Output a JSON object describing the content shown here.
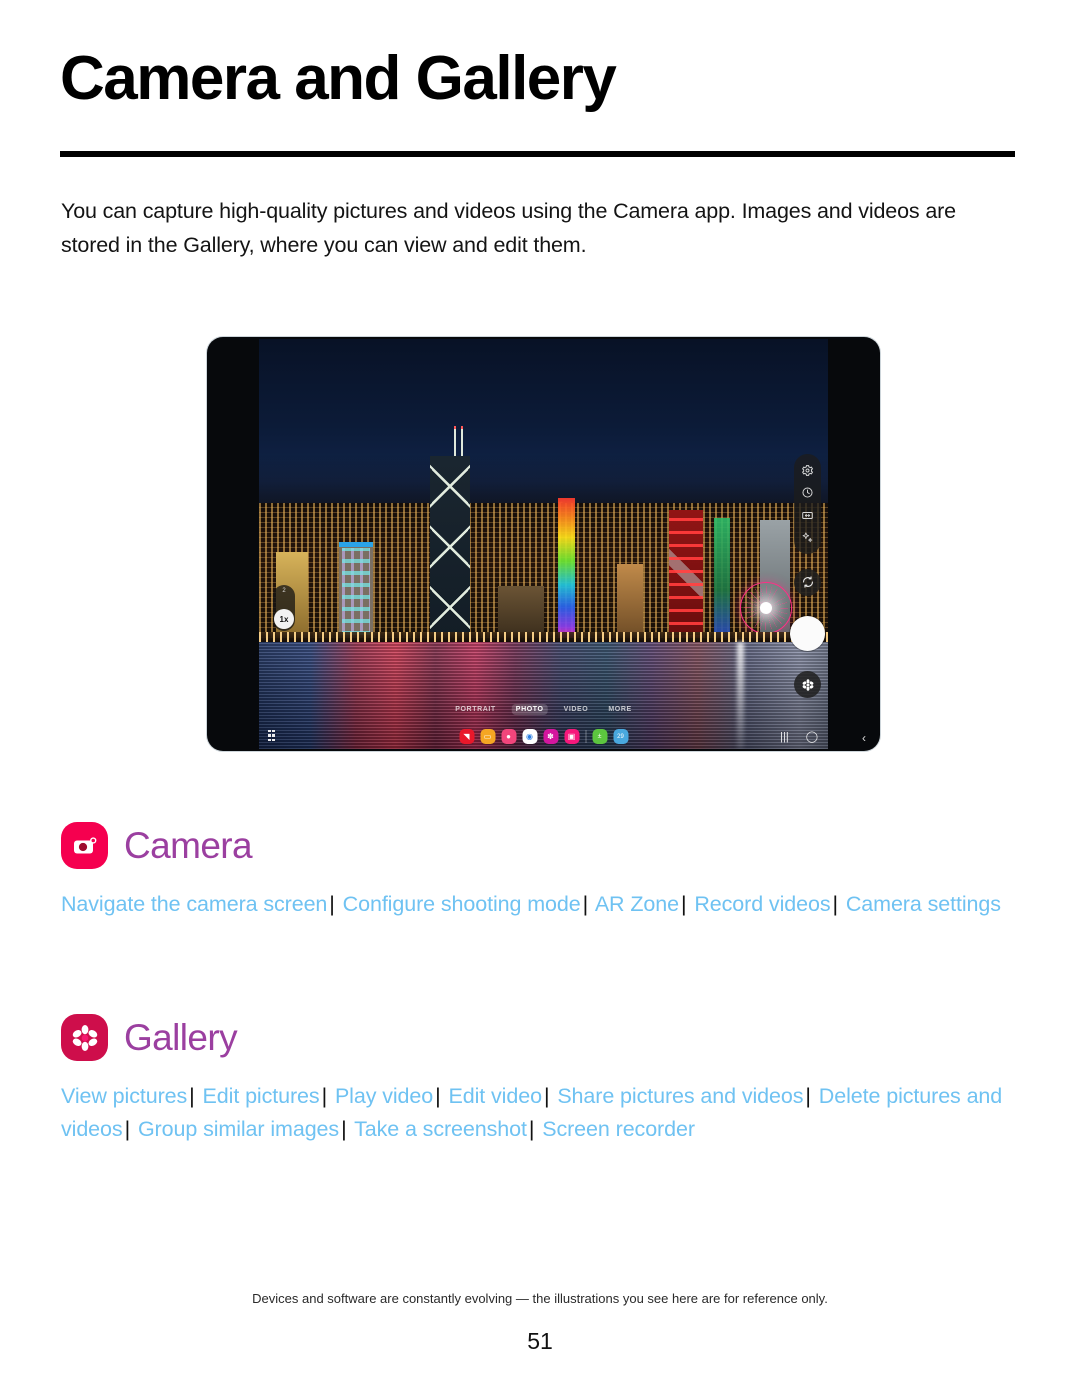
{
  "document": {
    "title": "Camera and Gallery",
    "intro": "You can capture high-quality pictures and videos using the Camera app. Images and videos are stored in the Gallery, where you can view and edit them.",
    "footnote": "Devices and software are constantly evolving — the illustrations you see here are for reference only.",
    "page_number": "51"
  },
  "colors": {
    "heading": "#000000",
    "rule": "#000000",
    "app_heading": "#9B3FA0",
    "link": "#6FC2F2",
    "camera_icon_bg": "#F5004F",
    "gallery_icon_bg": "#CE0E4B",
    "separator": "#111111"
  },
  "illustration": {
    "name": "camera-app-screenshot-tablet",
    "device": "tablet",
    "scene": "Hong Kong harbour skyline at night",
    "camera_ui": {
      "zoom_levels": {
        "secondary": "2",
        "selected": "1x"
      },
      "right_rail_icons": [
        "settings-gear-icon",
        "timer-icon",
        "aspect-ratio-icon",
        "effects-sparkle-icon"
      ],
      "flip_camera_icon": "switch-camera-icon",
      "shutter_icon": "shutter-button",
      "gallery_preview_icon": "gallery-flower-icon",
      "modes": [
        {
          "label": "PORTRAIT",
          "selected": false
        },
        {
          "label": "PHOTO",
          "selected": true
        },
        {
          "label": "VIDEO",
          "selected": false
        },
        {
          "label": "MORE",
          "selected": false
        }
      ],
      "taskbar": {
        "apps_button": "apps-grid-icon",
        "apps": [
          {
            "name": "flipboard-app-icon",
            "color": "#E8182A",
            "glyph": "◥"
          },
          {
            "name": "files-app-icon",
            "color": "#F5A623",
            "glyph": "▭"
          },
          {
            "name": "contacts-app-icon",
            "color": "#F2457B",
            "glyph": "●"
          },
          {
            "name": "chrome-app-icon",
            "color": "#FFFFFF",
            "glyph": "◉"
          },
          {
            "name": "gallery-app-icon",
            "color": "#D4169E",
            "glyph": "✽"
          },
          {
            "name": "camera-app-icon",
            "color": "#F5187B",
            "glyph": "▣"
          },
          {
            "name": "calculator-app-icon",
            "color": "#5CC63F",
            "glyph": "±"
          },
          {
            "name": "calendar-app-icon",
            "color": "#49A8DE",
            "glyph": "29"
          }
        ]
      },
      "navigation": {
        "recents_icon": "recents-icon",
        "home_icon": "home-icon",
        "back_icon": "back-chevron-icon"
      }
    }
  },
  "sections": [
    {
      "id": "camera",
      "icon_name": "camera-app-icon",
      "title": "Camera",
      "links": [
        "Navigate the camera screen",
        "Configure shooting mode",
        "AR Zone",
        "Record videos",
        "Camera settings"
      ]
    },
    {
      "id": "gallery",
      "icon_name": "gallery-app-icon",
      "title": "Gallery",
      "links": [
        "View pictures",
        "Edit pictures",
        "Play video",
        "Edit video",
        "Share pictures and videos",
        "Delete pictures and videos",
        "Group similar images",
        "Take a screenshot",
        "Screen recorder"
      ]
    }
  ]
}
